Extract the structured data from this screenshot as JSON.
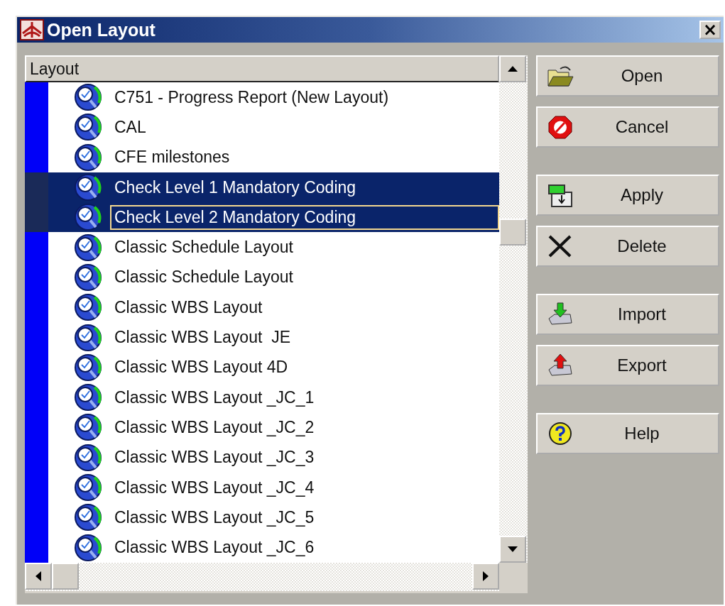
{
  "window": {
    "title": "Open Layout",
    "close": "×"
  },
  "list": {
    "header": "Layout",
    "rows": [
      {
        "label": "C751 - Progress Report (New Layout)",
        "selected": false,
        "focused": false
      },
      {
        "label": "CAL",
        "selected": false,
        "focused": false
      },
      {
        "label": "CFE milestones",
        "selected": false,
        "focused": false
      },
      {
        "label": "Check Level 1 Mandatory Coding",
        "selected": true,
        "focused": false
      },
      {
        "label": "Check Level 2 Mandatory Coding",
        "selected": true,
        "focused": true
      },
      {
        "label": "Classic Schedule Layout",
        "selected": false,
        "focused": false
      },
      {
        "label": "Classic Schedule Layout",
        "selected": false,
        "focused": false
      },
      {
        "label": "Classic WBS Layout",
        "selected": false,
        "focused": false
      },
      {
        "label": "Classic WBS Layout  JE",
        "selected": false,
        "focused": false
      },
      {
        "label": "Classic WBS Layout 4D",
        "selected": false,
        "focused": false
      },
      {
        "label": "Classic WBS Layout _JC_1",
        "selected": false,
        "focused": false
      },
      {
        "label": "Classic WBS Layout _JC_2",
        "selected": false,
        "focused": false
      },
      {
        "label": "Classic WBS Layout _JC_3",
        "selected": false,
        "focused": false
      },
      {
        "label": "Classic WBS Layout _JC_4",
        "selected": false,
        "focused": false
      },
      {
        "label": "Classic WBS Layout _JC_5",
        "selected": false,
        "focused": false
      },
      {
        "label": "Classic WBS Layout _JC_6",
        "selected": false,
        "focused": false
      }
    ]
  },
  "button_groups": [
    [
      {
        "label": "Open",
        "kind": "open"
      },
      {
        "label": "Cancel",
        "kind": "cancel"
      }
    ],
    [
      {
        "label": "Apply",
        "kind": "apply"
      },
      {
        "label": "Delete",
        "kind": "delete"
      }
    ],
    [
      {
        "label": "Import",
        "kind": "import"
      },
      {
        "label": "Export",
        "kind": "export"
      }
    ],
    [
      {
        "label": "Help",
        "kind": "help"
      }
    ]
  ]
}
